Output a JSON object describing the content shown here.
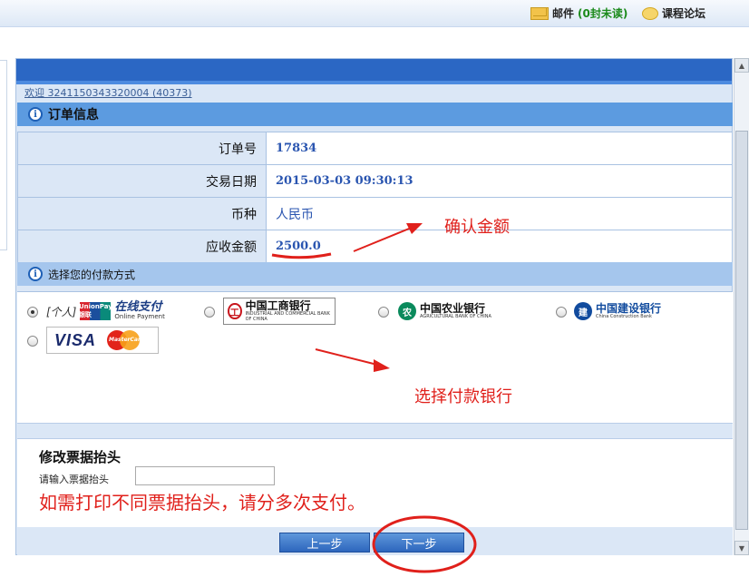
{
  "topbar": {
    "mail_label": "邮件",
    "mail_count": "(0封未读)",
    "forum_label": "课程论坛"
  },
  "welcome": "欢迎 3241150343320004 (40373)",
  "order": {
    "title": "订单信息",
    "rows": [
      {
        "label": "订单号",
        "value": "17834"
      },
      {
        "label": "交易日期",
        "value": "2015-03-03 09:30:13"
      },
      {
        "label": "币种",
        "value": "人民币"
      },
      {
        "label": "应收金额",
        "value": "2500.0"
      }
    ]
  },
  "payment": {
    "title": "选择您的付款方式",
    "options": [
      {
        "name": "unionpay",
        "prefix": "[个人]",
        "logo_text": "UnionPay 银联",
        "text": "在线支付",
        "sub": "Online Payment",
        "selected": true
      },
      {
        "name": "icbc",
        "text": "中国工商银行",
        "sub": "INDUSTRIAL AND COMMERCIAL BANK OF CHINA",
        "selected": false
      },
      {
        "name": "abc",
        "text": "中国农业银行",
        "sub": "AGRICULTURAL BANK OF CHINA",
        "selected": false
      },
      {
        "name": "ccb",
        "text": "中国建设银行",
        "sub": "China Construction Bank",
        "selected": false
      },
      {
        "name": "visa-mastercard",
        "text": "VISA",
        "sub": "MasterCard",
        "selected": false
      }
    ]
  },
  "invoice": {
    "title": "修改票据抬头",
    "input_label": "请输入票据抬头",
    "input_value": "",
    "warning": "如需打印不同票据抬头，请分多次支付。"
  },
  "buttons": {
    "prev": "上一步",
    "next": "下一步"
  },
  "annotations": {
    "confirm_amount": "确认金额",
    "choose_bank": "选择付款银行"
  },
  "colors": {
    "header_blue": "#2b67c4",
    "section_blue": "#5c9be0",
    "value_blue": "#2a55b0",
    "annotation_red": "#e0201b"
  }
}
